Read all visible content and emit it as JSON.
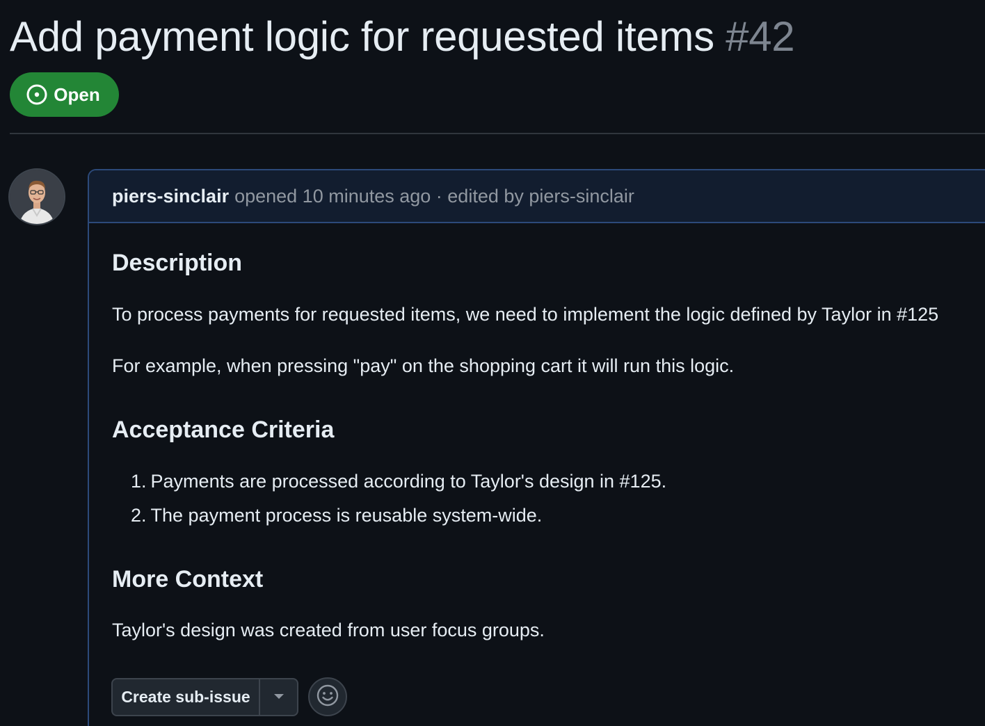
{
  "issue": {
    "title": "Add payment logic for requested items",
    "number": "#42",
    "state": "Open",
    "state_color": "#238636"
  },
  "comment": {
    "author": "piers-sinclair",
    "meta": "opened 10 minutes ago · edited by piers-sinclair",
    "body": {
      "description_heading": "Description",
      "description_p1": "To process payments for requested items, we need to implement the logic defined by Taylor in #125",
      "description_p2": "For example, when pressing \"pay\" on the shopping cart it will run this logic.",
      "acceptance_heading": "Acceptance Criteria",
      "acceptance_items": [
        {
          "num": "1.",
          "text": "Payments are processed according to Taylor's design in #125."
        },
        {
          "num": "2.",
          "text": "The payment process is reusable system-wide."
        }
      ],
      "context_heading": "More Context",
      "context_p1": "Taylor's design was created from user focus groups."
    },
    "actions": {
      "create_subissue_label": "Create sub-issue",
      "dropdown_icon": "triangle-down-icon",
      "reaction_icon": "smiley-icon"
    }
  },
  "icons": {
    "state": "issue-opened-icon",
    "avatar": "user-avatar"
  },
  "colors": {
    "background": "#0d1117",
    "header_bg": "#121d2f",
    "accent_border": "#2c4a7a",
    "muted_text": "#9198a1"
  }
}
